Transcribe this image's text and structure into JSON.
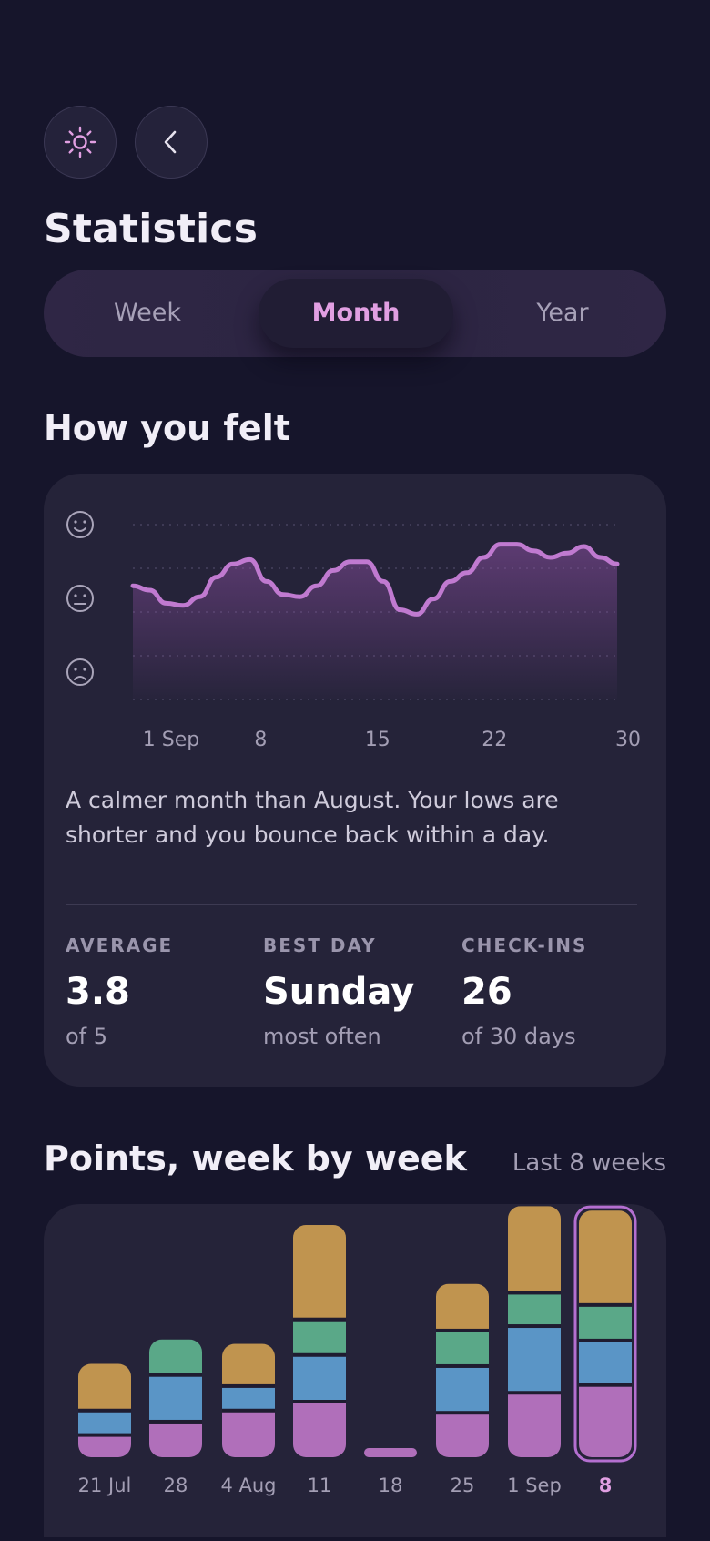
{
  "header": {
    "theme_icon": "sun-icon",
    "back_icon": "chevron-left-icon",
    "title": "Statistics"
  },
  "period_tabs": [
    {
      "label": "Week",
      "active": false
    },
    {
      "label": "Month",
      "active": true
    },
    {
      "label": "Year",
      "active": false
    }
  ],
  "mood": {
    "heading": "How you felt",
    "face_icons": [
      "smile-face-icon",
      "neutral-face-icon",
      "frown-face-icon"
    ],
    "description": "A calmer month than August. Your lows are shorter and you bounce back within a day.",
    "stats": [
      {
        "label": "AVERAGE",
        "value": "3.8",
        "sub": "of 5"
      },
      {
        "label": "BEST DAY",
        "value": "Sunday",
        "sub": "most often"
      },
      {
        "label": "CHECK-INS",
        "value": "26",
        "sub": "of 30 days"
      }
    ]
  },
  "points": {
    "heading": "Points, week by week",
    "range_label": "Last 8 weeks"
  },
  "colors": {
    "accent": "#e19fe2",
    "line": "#c07ad0",
    "gold": "#c0944f",
    "green": "#5aa888",
    "blue": "#5a95c6",
    "purple": "#b06fba"
  },
  "chart_data": [
    {
      "type": "area",
      "x_labels": [
        "1 Sep",
        "8",
        "15",
        "22",
        "30"
      ],
      "y_scale": [
        "frown",
        "neutral",
        "smile"
      ],
      "ylim": [
        1,
        5
      ],
      "grid": true,
      "x": [
        1,
        2,
        3,
        4,
        5,
        6,
        7,
        8,
        9,
        10,
        11,
        12,
        13,
        14,
        15,
        16,
        17,
        18,
        19,
        20,
        21,
        22,
        23,
        24,
        25,
        26,
        27,
        28,
        29,
        30
      ],
      "y": [
        3.6,
        3.5,
        3.2,
        3.15,
        3.35,
        3.8,
        4.1,
        4.2,
        3.7,
        3.4,
        3.35,
        3.6,
        3.95,
        4.15,
        4.15,
        3.7,
        3.05,
        2.95,
        3.3,
        3.7,
        3.9,
        4.25,
        4.55,
        4.55,
        4.4,
        4.25,
        4.35,
        4.5,
        4.25,
        4.1
      ]
    },
    {
      "type": "bar",
      "stacked": true,
      "categories": [
        "21 Jul",
        "28",
        "4 Aug",
        "11",
        "18",
        "25",
        "1 Sep",
        "8"
      ],
      "highlighted_category": "8",
      "series": [
        {
          "color": "purple",
          "values": [
            20,
            32,
            42,
            50,
            0,
            40,
            58,
            65
          ]
        },
        {
          "color": "blue",
          "values": [
            22,
            42,
            22,
            42,
            0,
            42,
            60,
            40
          ]
        },
        {
          "color": "green",
          "values": [
            0,
            32,
            0,
            32,
            0,
            32,
            30,
            32
          ]
        },
        {
          "color": "gold",
          "values": [
            42,
            0,
            38,
            85,
            0,
            42,
            78,
            85
          ]
        }
      ]
    }
  ]
}
